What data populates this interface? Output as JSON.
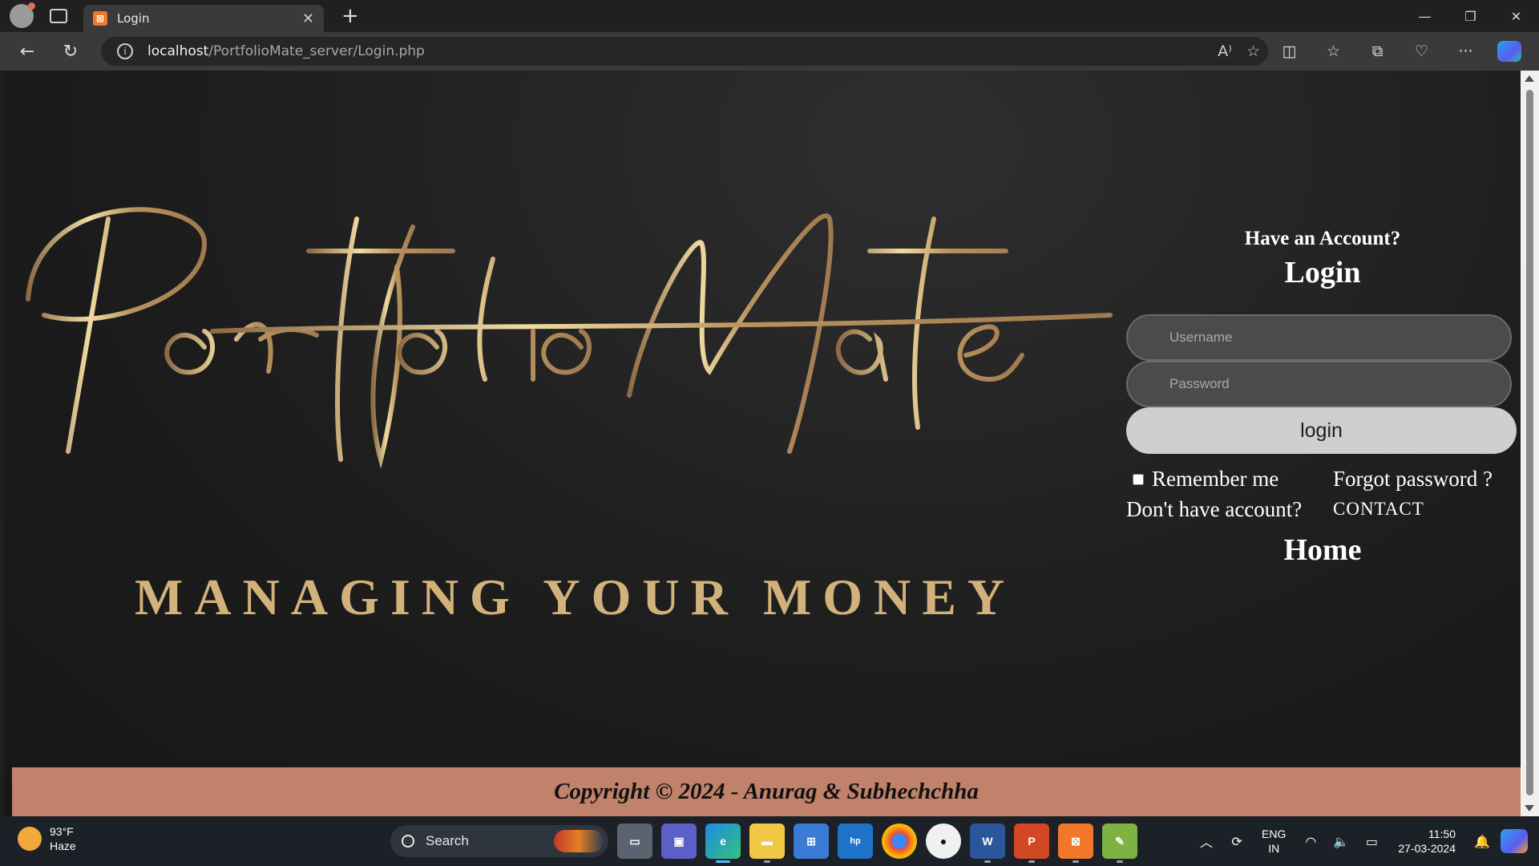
{
  "browser": {
    "tab_title": "Login",
    "tab_favicon": "xampp-icon",
    "url_host": "localhost",
    "url_path": "/PortfolioMate_server/Login.php"
  },
  "page": {
    "brand_name": "PortfolioMate",
    "tagline": "MANAGING YOUR MONEY",
    "login": {
      "have_account": "Have an Account?",
      "heading": "Login",
      "username_placeholder": "Username",
      "password_placeholder": "Password",
      "login_button": "login",
      "remember_me": "Remember me",
      "forgot_password": "Forgot password ?",
      "no_account": "Don't have account?",
      "contact": "CONTACT",
      "home": "Home"
    },
    "footer": "Copyright © 2024 - Anurag & Subhechchha",
    "colors": {
      "footer_bg": "#c0826a",
      "brand_gold": "#c9a46a",
      "login_button_bg": "#cfcfcf"
    }
  },
  "taskbar": {
    "weather_temp": "93°F",
    "weather_desc": "Haze",
    "search_label": "Search",
    "lang_top": "ENG",
    "lang_bottom": "IN",
    "time": "11:50",
    "date": "27-03-2024",
    "apps": [
      "file-explorer-icon",
      "teams-icon",
      "edge-icon",
      "folder-icon",
      "store-icon",
      "myhp-icon",
      "chrome-icon",
      "github-icon",
      "word-icon",
      "powerpoint-icon",
      "xampp-icon",
      "notepad-icon"
    ]
  }
}
